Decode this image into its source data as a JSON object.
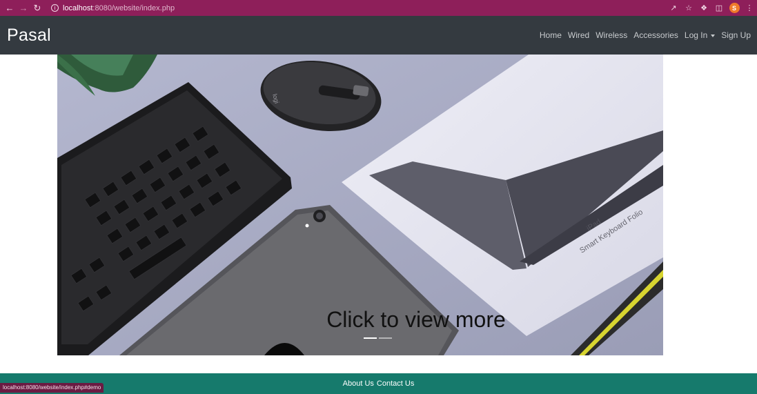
{
  "browser": {
    "url_host": "localhost",
    "url_path": ":8080/website/index.php",
    "profile_initial": "S",
    "status_url": "localhost:8080/website/index.php#demo"
  },
  "navbar": {
    "brand": "Pasal",
    "links": [
      "Home",
      "Wired",
      "Wireless",
      "Accessories",
      "Log In",
      "Sign Up"
    ]
  },
  "hero": {
    "caption": "Click to view more",
    "box_text_1": "iPad",
    "box_text_2": "Smart Keyboard Folio",
    "mouse_logo": "logi",
    "slide_count": 2,
    "active_slide": 1
  },
  "footer": {
    "about": "About Us",
    "contact": "Contact Us"
  },
  "colors": {
    "browser_frame": "#8e1f5a",
    "navbar": "#343a40",
    "footer": "#167a6c",
    "hero_background": "#a6a9c2"
  }
}
